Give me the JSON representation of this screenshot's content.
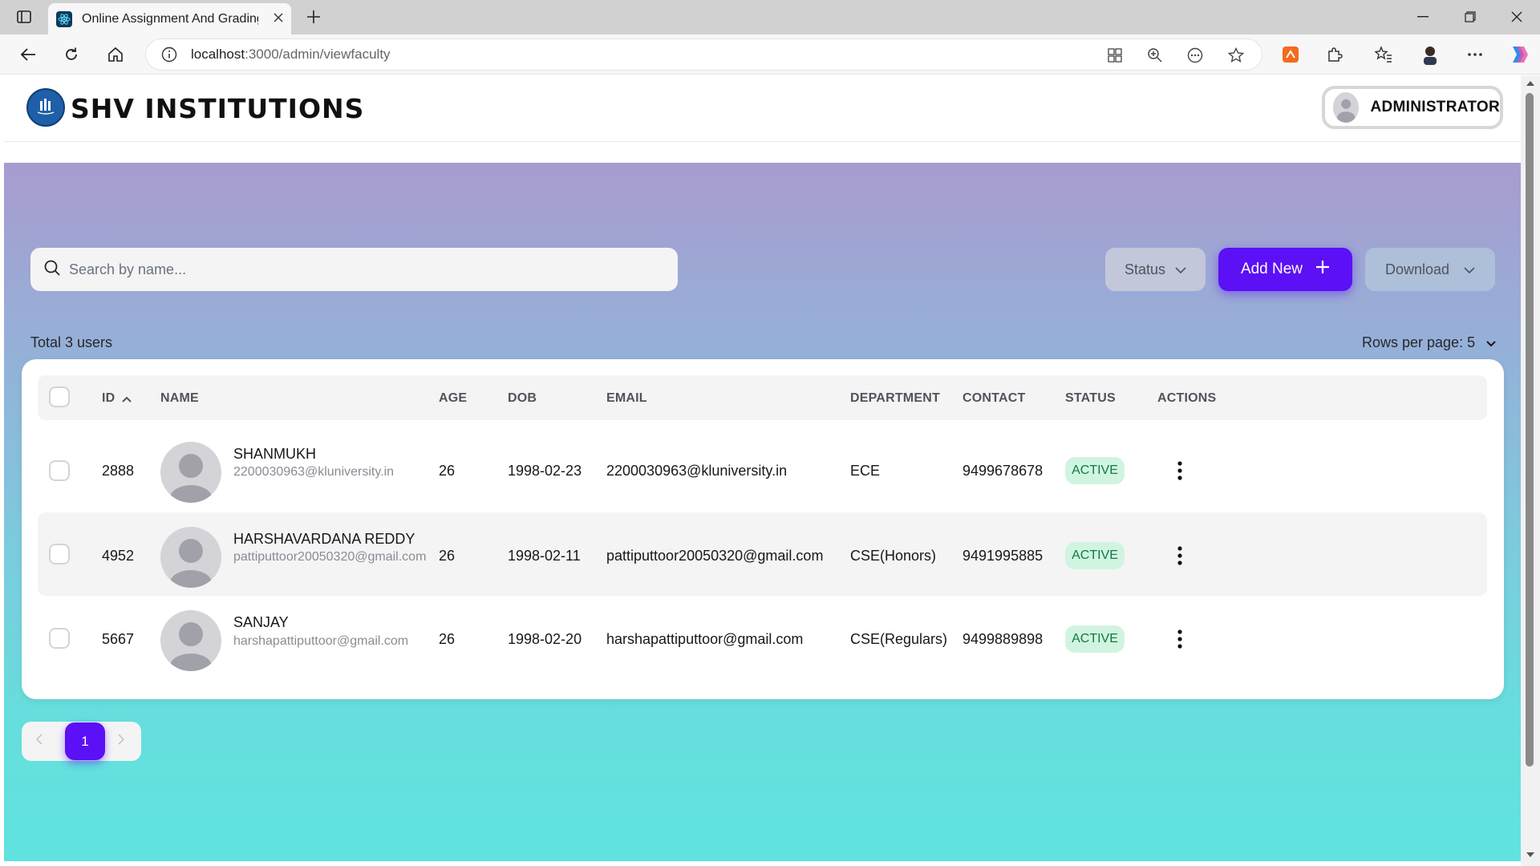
{
  "browser": {
    "tab_title": "Online Assignment And Grading S",
    "url_host": "localhost",
    "url_path": ":3000/admin/viewfaculty"
  },
  "header": {
    "brand": "SHV INSTITUTIONS",
    "user_label": "ADMINISTRATOR"
  },
  "toolbar": {
    "search_placeholder": "Search by name...",
    "status_label": "Status",
    "add_new_label": "Add New",
    "download_label": "Download"
  },
  "summary": {
    "total_users": "Total 3 users",
    "rows_per_page": "Rows per page: 5"
  },
  "table": {
    "columns": [
      "ID",
      "NAME",
      "AGE",
      "DOB",
      "EMAIL",
      "DEPARTMENT",
      "CONTACT",
      "STATUS",
      "ACTIONS"
    ],
    "rows": [
      {
        "id": "2888",
        "name": "SHANMUKH",
        "sub_email": "2200030963@kluniversity.in",
        "age": "26",
        "dob": "1998-02-23",
        "email": "2200030963@kluniversity.in",
        "department": "ECE",
        "contact": "9499678678",
        "status": "ACTIVE"
      },
      {
        "id": "4952",
        "name": "HARSHAVARDANA REDDY",
        "sub_email": "pattiputtoor20050320@gmail.com",
        "age": "26",
        "dob": "1998-02-11",
        "email": "pattiputtoor20050320@gmail.com",
        "department": "CSE(Honors)",
        "contact": "9491995885",
        "status": "ACTIVE"
      },
      {
        "id": "5667",
        "name": "SANJAY",
        "sub_email": "harshapattiputtoor@gmail.com",
        "age": "26",
        "dob": "1998-02-20",
        "email": "harshapattiputtoor@gmail.com",
        "department": "CSE(Regulars)",
        "contact": "9499889898",
        "status": "ACTIVE"
      }
    ]
  },
  "pagination": {
    "current_page": "1"
  },
  "colors": {
    "accent": "#5b10f5",
    "active_badge_bg": "#d1f4e0",
    "active_badge_text": "#0e7a43"
  }
}
